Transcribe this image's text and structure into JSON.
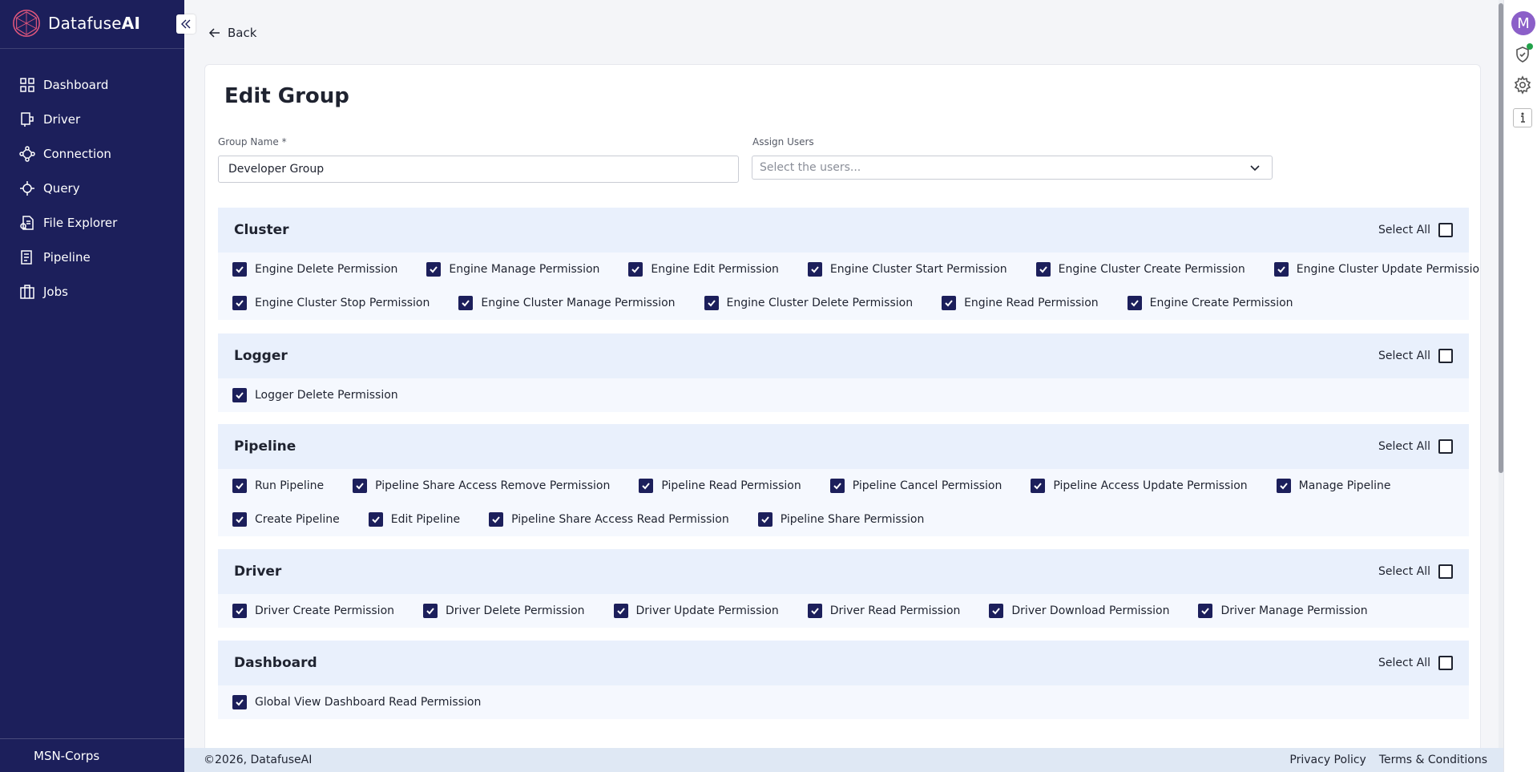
{
  "brand": {
    "name_prefix": "Datafuse",
    "name_suffix": "AI"
  },
  "sidebar": {
    "items": [
      {
        "label": "Dashboard",
        "icon": "dashboard-icon"
      },
      {
        "label": "Driver",
        "icon": "driver-icon"
      },
      {
        "label": "Connection",
        "icon": "connection-icon"
      },
      {
        "label": "Query",
        "icon": "query-icon"
      },
      {
        "label": "File Explorer",
        "icon": "file-explorer-icon"
      },
      {
        "label": "Pipeline",
        "icon": "pipeline-icon"
      },
      {
        "label": "Jobs",
        "icon": "jobs-icon"
      }
    ],
    "org": "MSN-Corps"
  },
  "rail": {
    "avatar_letter": "M"
  },
  "back_label": "Back",
  "form": {
    "title": "Edit Group",
    "group_name_label": "Group Name *",
    "group_name_value": "Developer Group",
    "assign_users_label": "Assign Users",
    "assign_users_placeholder": "Select the users..."
  },
  "select_all_label": "Select All",
  "sections": [
    {
      "title": "Cluster",
      "rows": [
        [
          "Engine Delete Permission",
          "Engine Manage Permission",
          "Engine Edit Permission",
          "Engine Cluster Start Permission",
          "Engine Cluster Create Permission",
          "Engine Cluster Update Permission"
        ],
        [
          "Engine Cluster Stop Permission",
          "Engine Cluster Manage Permission",
          "Engine Cluster Delete Permission",
          "Engine Read Permission",
          "Engine Create Permission"
        ]
      ]
    },
    {
      "title": "Logger",
      "rows": [
        [
          "Logger Delete Permission"
        ]
      ]
    },
    {
      "title": "Pipeline",
      "rows": [
        [
          "Run Pipeline",
          "Pipeline Share Access Remove Permission",
          "Pipeline Read Permission",
          "Pipeline Cancel Permission",
          "Pipeline Access Update Permission",
          "Manage Pipeline"
        ],
        [
          "Create Pipeline",
          "Edit Pipeline",
          "Pipeline Share Access Read Permission",
          "Pipeline Share Permission"
        ]
      ]
    },
    {
      "title": "Driver",
      "rows": [
        [
          "Driver Create Permission",
          "Driver Delete Permission",
          "Driver Update Permission",
          "Driver Read Permission",
          "Driver Download Permission",
          "Driver Manage Permission"
        ]
      ]
    },
    {
      "title": "Dashboard",
      "rows": [
        [
          "Global View Dashboard Read Permission"
        ]
      ]
    }
  ],
  "footer": {
    "copyright": "©2026, DatafuseAI",
    "privacy": "Privacy Policy",
    "terms": "Terms & Conditions"
  }
}
